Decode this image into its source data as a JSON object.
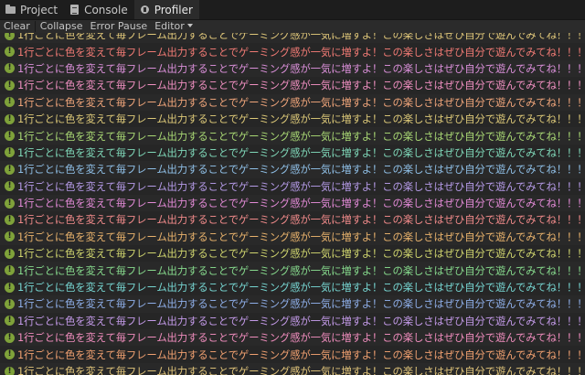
{
  "tabs": [
    {
      "label": "Project",
      "icon": "folder-icon",
      "active": false
    },
    {
      "label": "Console",
      "icon": "console-icon",
      "active": false
    },
    {
      "label": "Profiler",
      "icon": "profiler-icon",
      "active": true
    }
  ],
  "toolbar": {
    "clear_label": "Clear",
    "collapse_label": "Collapse",
    "error_pause_label": "Error Pause",
    "editor_label": "Editor"
  },
  "log": {
    "icon_glyph": "!",
    "message": "1行ごとに色を変えて毎フレーム出力することでゲーミング感が一気に増すよ！この楽しさはぜひ自分で遊んでみてね！！！",
    "colors": [
      "#e0c77a",
      "#f07a74",
      "#d98fd8",
      "#ef8fc0",
      "#f0a57a",
      "#dcc878",
      "#a9d874",
      "#7fd7b8",
      "#8fbfe6",
      "#b49ae6",
      "#e28ad6",
      "#f08a8a",
      "#e8b26c",
      "#cfd46e",
      "#86d98c",
      "#76d4d0",
      "#8eaee8",
      "#c39ae8",
      "#ee8cbc",
      "#f0a070",
      "#e0c47a"
    ]
  }
}
